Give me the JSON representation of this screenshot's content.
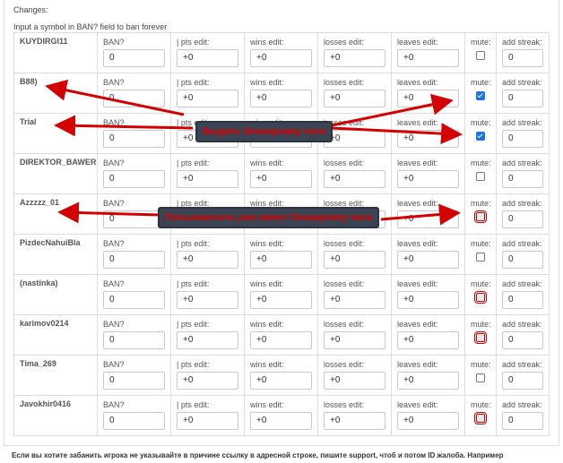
{
  "panel": {
    "title": "Changes:",
    "hint": "Input a symbol in BAN? field to ban forever"
  },
  "labels": {
    "ban": "BAN?",
    "pts": "| pts edit:",
    "wins": "wins edit:",
    "losses": "losses edit:",
    "leaves": "leaves edit:",
    "mute": "mute:",
    "streak": "add streak:"
  },
  "rows": [
    {
      "name": "KUYDIRGI11",
      "ban": "0",
      "pts": "+0",
      "wins": "+0",
      "losses": "+0",
      "leaves": "+0",
      "mute": "unchecked",
      "streak": "0"
    },
    {
      "name": "B88)",
      "ban": "0",
      "pts": "+0",
      "wins": "+0",
      "losses": "+0",
      "leaves": "+0",
      "mute": "checked",
      "streak": "0"
    },
    {
      "name": "Trial",
      "ban": "0",
      "pts": "+0",
      "wins": "+0",
      "losses": "+0",
      "leaves": "+0",
      "mute": "checked",
      "streak": "0"
    },
    {
      "name": "DIREKTOR_BAWER",
      "ban": "0",
      "pts": "+0",
      "wins": "+0",
      "losses": "+0",
      "leaves": "+0",
      "mute": "unchecked",
      "streak": "0"
    },
    {
      "name": "Azzzzz_01",
      "ban": "0",
      "pts": "+0",
      "wins": "+0",
      "losses": "+0",
      "leaves": "+0",
      "mute": "disabled",
      "streak": "0"
    },
    {
      "name": "PizdecNahuiBla",
      "ban": "0",
      "pts": "+0",
      "wins": "+0",
      "losses": "+0",
      "leaves": "+0",
      "mute": "unchecked",
      "streak": "0"
    },
    {
      "name": "(nastinka)",
      "ban": "0",
      "pts": "+0",
      "wins": "+0",
      "losses": "+0",
      "leaves": "+0",
      "mute": "disabled",
      "streak": "0"
    },
    {
      "name": "karimov0214",
      "ban": "0",
      "pts": "+0",
      "wins": "+0",
      "losses": "+0",
      "leaves": "+0",
      "mute": "disabled",
      "streak": "0"
    },
    {
      "name": "Tima_269",
      "ban": "0",
      "pts": "+0",
      "wins": "+0",
      "losses": "+0",
      "leaves": "+0",
      "mute": "unchecked",
      "streak": "0"
    },
    {
      "name": "Javokhir0416",
      "ban": "0",
      "pts": "+0",
      "wins": "+0",
      "losses": "+0",
      "leaves": "+0",
      "mute": "disabled",
      "streak": "0"
    }
  ],
  "annotations": {
    "callout_1": "Выдать блокировку чата",
    "callout_2": "Пользователь уже имеет блокировку чата",
    "arrow_color": "#d40000"
  },
  "footer": {
    "text": "Если вы хотите забанить игрока не указывайте в причине ссылку в адресной строке, пишите support, чтоб и потом ID жалоба. Например"
  }
}
